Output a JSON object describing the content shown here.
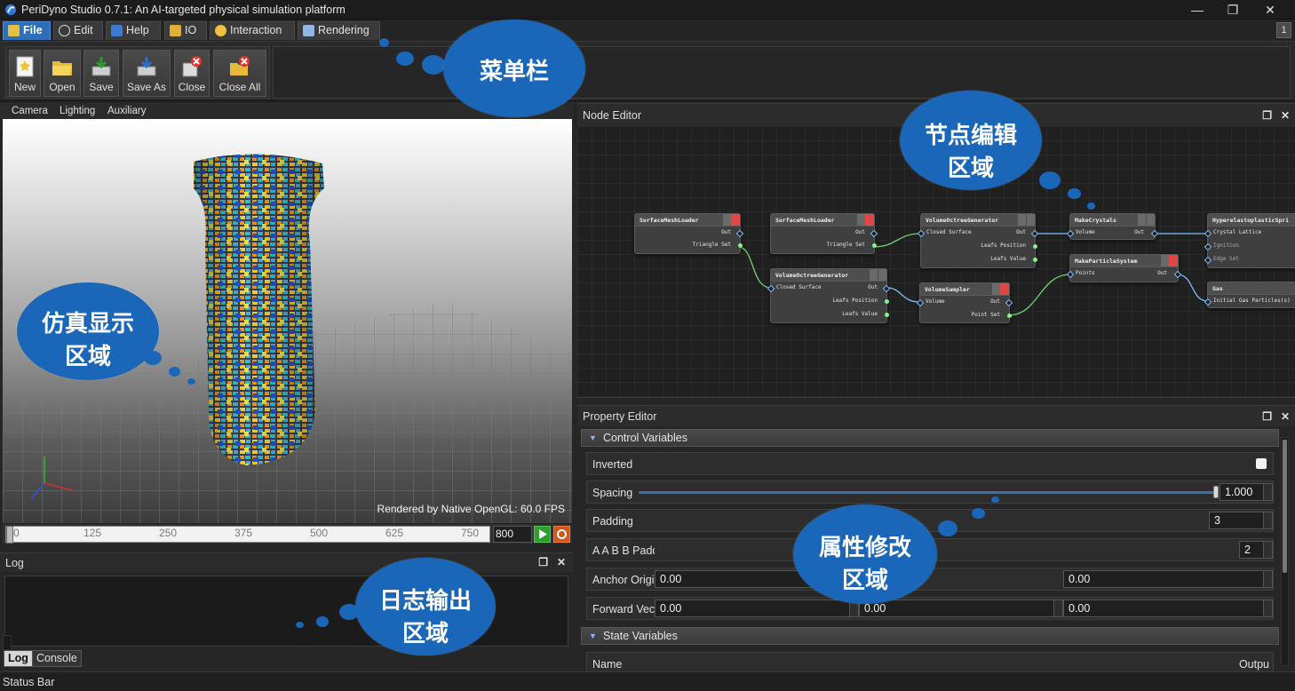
{
  "window": {
    "title": "PeriDyno Studio 0.7.1:  An AI-targeted physical simulation platform",
    "controls": [
      "minimize",
      "maximize",
      "close"
    ]
  },
  "menu": {
    "tabs": [
      {
        "label": "File",
        "icon": "folder-icon",
        "active": true
      },
      {
        "label": "Edit",
        "icon": "gear-icon"
      },
      {
        "label": "Help",
        "icon": "book-icon"
      },
      {
        "label": "IO",
        "icon": "io-icon"
      },
      {
        "label": "Interaction",
        "icon": "lightbulb-icon"
      },
      {
        "label": "Rendering",
        "icon": "monitor-icon"
      }
    ],
    "page_indicator": "1"
  },
  "toolbar": {
    "buttons": [
      {
        "label": "New",
        "icon": "new-file-icon"
      },
      {
        "label": "Open",
        "icon": "open-folder-icon"
      },
      {
        "label": "Save",
        "icon": "save-icon"
      },
      {
        "label": "Save As",
        "icon": "save-as-icon"
      },
      {
        "label": "Close",
        "icon": "close-file-icon"
      },
      {
        "label": "Close All",
        "icon": "close-all-icon"
      }
    ]
  },
  "viewport": {
    "menu": [
      "Camera",
      "Lighting",
      "Auxiliary"
    ],
    "render_info": "Rendered by Native OpenGL: 60.0 FPS"
  },
  "timeline": {
    "ticks": [
      "0",
      "125",
      "250",
      "375",
      "500",
      "625",
      "750"
    ],
    "frame": "800",
    "progress": 0
  },
  "log": {
    "title": "Log",
    "tabs": [
      "Log",
      "Console"
    ],
    "active_tab": "Log"
  },
  "status_bar": "Status Bar",
  "node_editor": {
    "title": "Node Editor",
    "nodes": [
      {
        "title": "SurfaceMeshLoader",
        "outputs": [
          "Out",
          "Triangle Set"
        ]
      },
      {
        "title": "SurfaceMeshLoader",
        "outputs": [
          "Out",
          "Triangle Set"
        ]
      },
      {
        "title": "VolumeOctreeGenerator",
        "inputs": [
          "Closed Surface"
        ],
        "outputs": [
          "Out",
          "Leafs Position",
          "Leafs Value"
        ]
      },
      {
        "title": "VolumeOctreeGenerator",
        "inputs": [
          "Closed Surface"
        ],
        "outputs": [
          "Out",
          "Leafs Position",
          "Leafs Value"
        ]
      },
      {
        "title": "VolumeSampler",
        "inputs": [
          "Volume"
        ],
        "outputs": [
          "Out",
          "Point Set"
        ]
      },
      {
        "title": "MakeCrystals",
        "inputs": [
          "Volume"
        ],
        "outputs": [
          "Out"
        ]
      },
      {
        "title": "MakeParticleSystem",
        "inputs": [
          "Points"
        ],
        "outputs": [
          "Out"
        ]
      },
      {
        "title": "HyperelastoplasticSpri",
        "inputs": [
          "Crystal Lattice",
          "Ignition",
          "Edge Set"
        ]
      },
      {
        "title": "Gas",
        "inputs": [
          "Initial Gas Particles(s)"
        ]
      }
    ]
  },
  "property_editor": {
    "title": "Property Editor",
    "sections": {
      "control": "Control Variables",
      "state": "State Variables"
    },
    "rows": {
      "inverted": {
        "label": "Inverted"
      },
      "spacing": {
        "label": "Spacing",
        "value": "1.000",
        "slider": 1.0
      },
      "padding": {
        "label": "Padding",
        "value": "3"
      },
      "aabb": {
        "label": "A A B B Padd",
        "value": "2"
      },
      "anchor": {
        "label": "Anchor Origi",
        "x": "0.00",
        "z": "0.00"
      },
      "forward": {
        "label": "Forward Vec",
        "x": "0.00",
        "y": "0.00",
        "z": "0.00"
      },
      "name": {
        "label": "Name",
        "value": "Outpu"
      }
    }
  },
  "annotations": {
    "menu": "菜单栏",
    "node_line1": "节点编辑",
    "node_line2": "区域",
    "sim_line1": "仿真显示",
    "sim_line2": "区域",
    "log_line1": "日志输出",
    "log_line2": "区域",
    "prop_line1": "属性修改",
    "prop_line2": "区域"
  },
  "colors": {
    "annotation": "#1a66b9",
    "active_tab": "#2f6fb8",
    "accent_red": "#e04646"
  }
}
